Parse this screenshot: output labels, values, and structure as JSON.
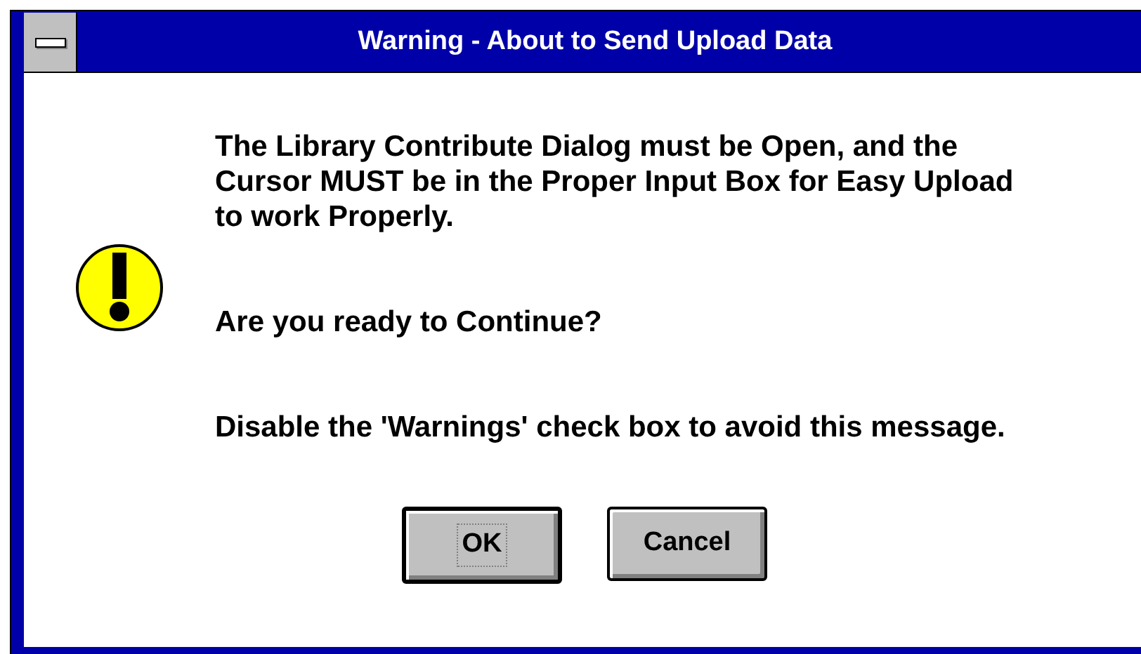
{
  "window": {
    "title": "Warning - About to Send Upload Data"
  },
  "message": {
    "paragraphs": [
      "The Library Contribute Dialog must be Open, and the Cursor MUST be in the Proper Input Box for Easy Upload to work Properly.",
      "Are you ready to Continue?",
      "Disable the 'Warnings' check box to avoid this message."
    ]
  },
  "buttons": [
    {
      "label": "OK",
      "default": true
    },
    {
      "label": "Cancel",
      "default": false
    }
  ]
}
